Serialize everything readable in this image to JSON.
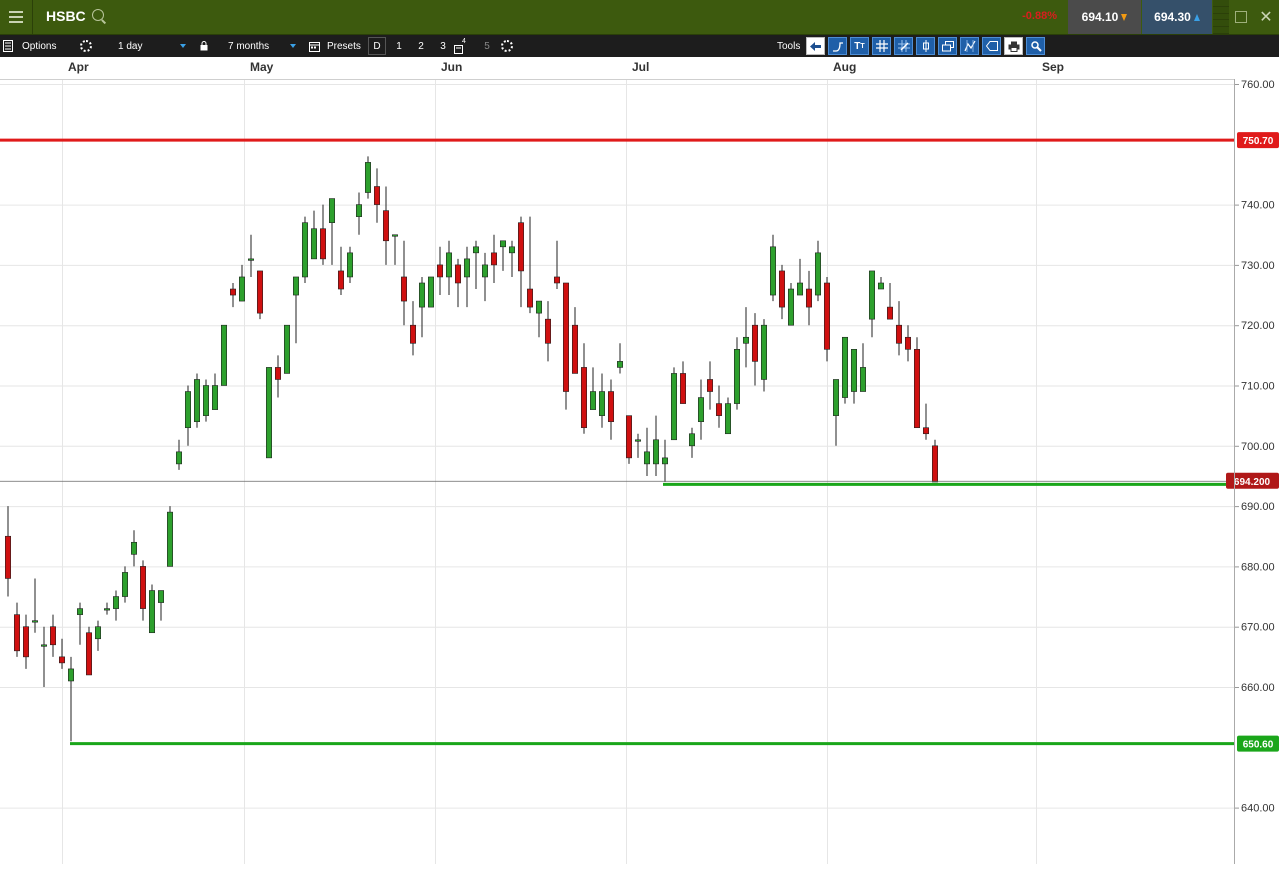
{
  "header": {
    "symbol": "HSBC",
    "change_pct": "-0.88%",
    "bid": "694.10",
    "ask": "694.30",
    "icons": [
      "menu-icon",
      "search-icon",
      "detach-icon",
      "close-icon"
    ]
  },
  "toolbar": {
    "options_label": "Options",
    "interval": "1 day",
    "range": "7 months",
    "presets_label": "Presets",
    "presets": [
      "D",
      "1",
      "2",
      "3",
      "4",
      "5"
    ],
    "tools_label": "Tools"
  },
  "colors": {
    "topbar": "#3d5a0e",
    "bull": "#2da02d",
    "bear": "#d01010",
    "resistance": "#e01a1a",
    "support": "#1aa61a",
    "price_tag": "#b01818"
  },
  "chart_data": {
    "type": "candlestick",
    "x_labels": [
      "Apr",
      "May",
      "Jun",
      "Jul",
      "Aug",
      "Sep"
    ],
    "y_ticks": [
      "760.00",
      "740.00",
      "730.00",
      "720.00",
      "710.00",
      "700.00",
      "690.00",
      "680.00",
      "670.00",
      "660.00",
      "640.00"
    ],
    "ylim": [
      638,
      761
    ],
    "grid": true,
    "resistance": {
      "value": 750.7,
      "label": "750.70"
    },
    "support_lines": [
      {
        "value": 693.6,
        "label": ""
      },
      {
        "value": 650.6,
        "label": "650.60"
      }
    ],
    "current_price": {
      "value": 694.2,
      "label": "694.200"
    },
    "candles": [
      [
        685,
        690,
        675,
        678
      ],
      [
        672,
        674,
        665,
        666
      ],
      [
        670,
        672,
        663,
        665
      ],
      [
        671,
        678,
        669,
        671
      ],
      [
        667,
        670,
        660,
        667
      ],
      [
        670,
        672,
        665,
        667
      ],
      [
        665,
        668,
        663,
        664
      ],
      [
        661,
        665,
        651,
        663
      ],
      [
        672,
        674,
        667,
        673
      ],
      [
        669,
        670,
        662,
        662
      ],
      [
        668,
        671,
        666,
        670
      ],
      [
        673,
        674,
        672,
        673
      ],
      [
        673,
        676,
        671,
        675
      ],
      [
        675,
        680,
        674,
        679
      ],
      [
        682,
        686,
        680,
        684
      ],
      [
        680,
        681,
        671,
        673
      ],
      [
        669,
        677,
        670,
        676
      ],
      [
        674,
        676,
        671,
        676
      ],
      [
        680,
        690,
        682,
        689
      ],
      [
        697,
        701,
        696,
        699
      ],
      [
        703,
        710,
        700,
        709
      ],
      [
        704,
        712,
        703,
        711
      ],
      [
        705,
        711,
        704,
        710
      ],
      [
        706,
        712,
        706,
        710
      ],
      [
        710,
        720,
        710,
        720
      ],
      [
        726,
        727,
        723,
        725
      ],
      [
        724,
        730,
        724,
        728
      ],
      [
        731,
        735,
        728,
        731
      ],
      [
        729,
        729,
        721,
        722
      ],
      [
        698,
        713,
        698,
        713
      ],
      [
        713,
        715,
        708,
        711
      ],
      [
        712,
        720,
        712,
        720
      ],
      [
        725,
        728,
        717,
        728
      ],
      [
        728,
        738,
        727,
        737
      ],
      [
        731,
        739,
        731,
        736
      ],
      [
        736,
        740,
        730,
        731
      ],
      [
        737,
        741,
        730,
        741
      ],
      [
        729,
        733,
        725,
        726
      ],
      [
        728,
        733,
        727,
        732
      ],
      [
        738,
        742,
        735,
        740
      ],
      [
        742,
        748,
        741,
        747
      ],
      [
        743,
        746,
        737,
        740
      ],
      [
        739,
        743,
        730,
        734
      ],
      [
        735,
        735,
        730,
        735
      ],
      [
        728,
        734,
        720,
        724
      ],
      [
        720,
        724,
        715,
        717
      ],
      [
        723,
        728,
        718,
        727
      ],
      [
        723,
        728,
        725,
        728
      ],
      [
        730,
        733,
        725,
        728
      ],
      [
        728,
        734,
        725,
        732
      ],
      [
        730,
        731,
        723,
        727
      ],
      [
        728,
        733,
        723,
        731
      ],
      [
        732,
        734,
        726,
        733
      ],
      [
        728,
        732,
        724,
        730
      ],
      [
        732,
        735,
        727,
        730
      ],
      [
        733,
        734,
        729,
        734
      ],
      [
        732,
        734,
        728,
        733
      ],
      [
        737,
        738,
        723,
        729
      ],
      [
        726,
        738,
        722,
        723
      ],
      [
        722,
        724,
        718,
        724
      ],
      [
        721,
        724,
        714,
        717
      ],
      [
        728,
        734,
        726,
        727
      ],
      [
        727,
        727,
        706,
        709
      ],
      [
        720,
        723,
        712,
        712
      ],
      [
        713,
        717,
        702,
        703
      ],
      [
        706,
        713,
        707,
        709
      ],
      [
        705,
        712,
        703,
        709
      ],
      [
        709,
        711,
        701,
        704
      ],
      [
        713,
        717,
        712,
        714
      ],
      [
        705,
        705,
        697,
        698
      ],
      [
        701,
        702,
        698,
        701
      ],
      [
        697,
        703,
        695,
        699
      ],
      [
        697,
        705,
        695,
        701
      ],
      [
        697,
        701,
        694,
        698
      ],
      [
        701,
        713,
        701,
        712
      ],
      [
        712,
        714,
        707,
        707
      ],
      [
        700,
        703,
        698,
        702
      ],
      [
        704,
        711,
        701,
        708
      ],
      [
        711,
        714,
        706,
        709
      ],
      [
        707,
        710,
        703,
        705
      ],
      [
        702,
        708,
        703,
        707
      ],
      [
        707,
        718,
        706,
        716
      ],
      [
        717,
        723,
        713,
        718
      ],
      [
        720,
        722,
        710,
        714
      ],
      [
        711,
        721,
        709,
        720
      ],
      [
        725,
        735,
        724,
        733
      ],
      [
        729,
        730,
        721,
        723
      ],
      [
        720,
        727,
        720,
        726
      ],
      [
        725,
        731,
        725,
        727
      ],
      [
        726,
        729,
        720,
        723
      ],
      [
        725,
        734,
        724,
        732
      ],
      [
        727,
        728,
        714,
        716
      ],
      [
        705,
        708,
        700,
        711
      ],
      [
        708,
        709,
        707,
        718
      ],
      [
        709,
        709,
        707,
        716
      ],
      [
        709,
        717,
        709,
        713
      ],
      [
        721,
        722,
        718,
        729
      ],
      [
        726,
        728,
        726,
        727
      ],
      [
        723,
        727,
        721,
        721
      ],
      [
        720,
        724,
        715,
        717
      ],
      [
        718,
        720,
        714,
        716
      ],
      [
        716,
        718,
        703,
        703
      ],
      [
        703,
        707,
        701,
        702
      ],
      [
        700,
        701,
        694,
        694
      ]
    ]
  }
}
